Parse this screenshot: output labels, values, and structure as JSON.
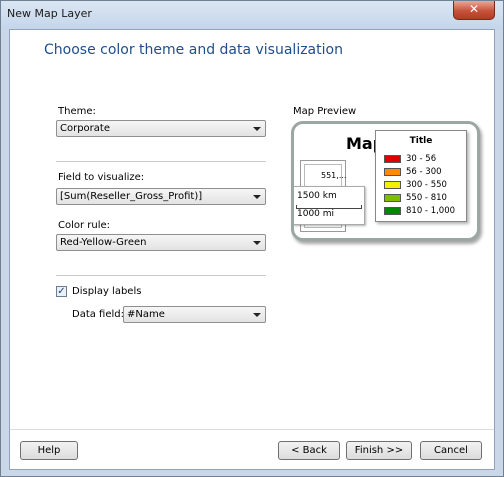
{
  "window": {
    "title": "New Map Layer",
    "close_glyph": "✕"
  },
  "heading": "Choose color theme and data visualization",
  "theme": {
    "label": "Theme:",
    "value": "Corporate"
  },
  "field": {
    "label": "Field to visualize:",
    "value": "[Sum(Reseller_Gross_Profit)]"
  },
  "color_rule": {
    "label": "Color rule:",
    "value": "Red-Yellow-Green"
  },
  "display_labels": {
    "label": "Display labels",
    "checked": true,
    "check_glyph": "✓"
  },
  "data_field": {
    "label": "Data field:",
    "value": "#Name"
  },
  "preview": {
    "label": "Map Preview",
    "map_title": "Map",
    "map_value": "551,...",
    "scale_km": "1500 km",
    "scale_mi": "1000 mi",
    "legend": {
      "title": "Title",
      "items": [
        {
          "text": "30 - 56",
          "color": "#e00000"
        },
        {
          "text": "56 - 300",
          "color": "#ff8a00"
        },
        {
          "text": "300 - 550",
          "color": "#f4f000"
        },
        {
          "text": "550 - 810",
          "color": "#7ec000"
        },
        {
          "text": "810 - 1,000",
          "color": "#008a00"
        }
      ]
    }
  },
  "buttons": {
    "help": "Help",
    "back": "< Back",
    "finish": "Finish >>",
    "cancel": "Cancel"
  }
}
